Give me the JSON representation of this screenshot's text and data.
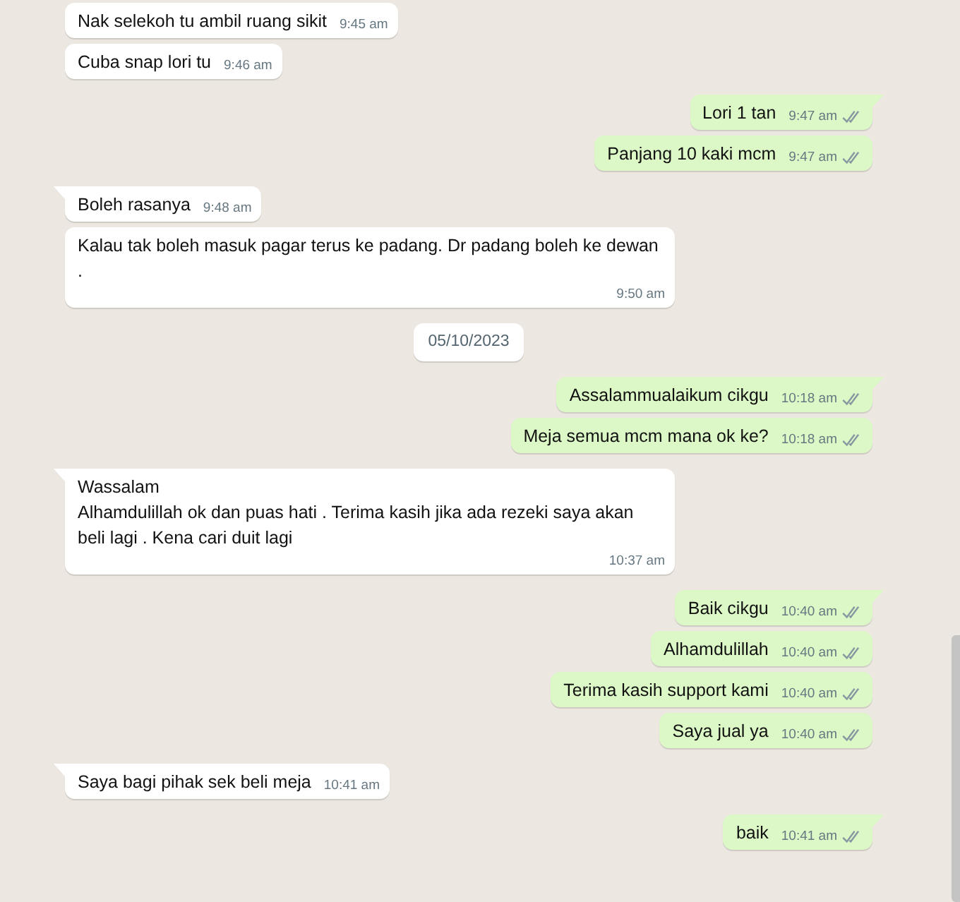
{
  "messages": [
    {
      "kind": "in",
      "tail": false,
      "text": "Nak selekoh tu ambil ruang sikit",
      "time": "9:45 am"
    },
    {
      "kind": "in",
      "tail": false,
      "text": "Cuba snap lori tu",
      "time": "9:46 am"
    },
    {
      "kind": "out",
      "tail": true,
      "text": "Lori 1 tan",
      "time": "9:47 am",
      "read": false
    },
    {
      "kind": "out",
      "tail": false,
      "text": "Panjang 10 kaki mcm",
      "time": "9:47 am",
      "read": false
    },
    {
      "kind": "in",
      "tail": true,
      "text": "Boleh rasanya",
      "time": "9:48 am"
    },
    {
      "kind": "in",
      "tail": false,
      "text": "Kalau tak boleh masuk pagar terus ke padang. Dr padang boleh ke dewan .",
      "time": "9:50 am"
    },
    {
      "kind": "date",
      "text": "05/10/2023"
    },
    {
      "kind": "out",
      "tail": true,
      "text": "Assalammualaikum cikgu",
      "time": "10:18 am",
      "read": false
    },
    {
      "kind": "out",
      "tail": false,
      "text": "Meja semua mcm mana ok ke?",
      "time": "10:18 am",
      "read": false
    },
    {
      "kind": "in",
      "tail": true,
      "text": "Wassalam\nAlhamdulillah ok dan puas hati . Terima kasih jika ada rezeki saya akan beli lagi . Kena cari duit lagi",
      "time": "10:37 am"
    },
    {
      "kind": "out",
      "tail": true,
      "text": "Baik cikgu",
      "time": "10:40 am",
      "read": false
    },
    {
      "kind": "out",
      "tail": false,
      "text": "Alhamdulillah",
      "time": "10:40 am",
      "read": false
    },
    {
      "kind": "out",
      "tail": false,
      "text": "Terima kasih support kami",
      "time": "10:40 am",
      "read": false
    },
    {
      "kind": "out",
      "tail": false,
      "text": "Saya jual ya",
      "time": "10:40 am",
      "read": false
    },
    {
      "kind": "in",
      "tail": true,
      "text": "Saya bagi pihak sek beli meja",
      "time": "10:41 am"
    },
    {
      "kind": "out",
      "tail": true,
      "text": "baik",
      "time": "10:41 am",
      "read": false
    }
  ]
}
